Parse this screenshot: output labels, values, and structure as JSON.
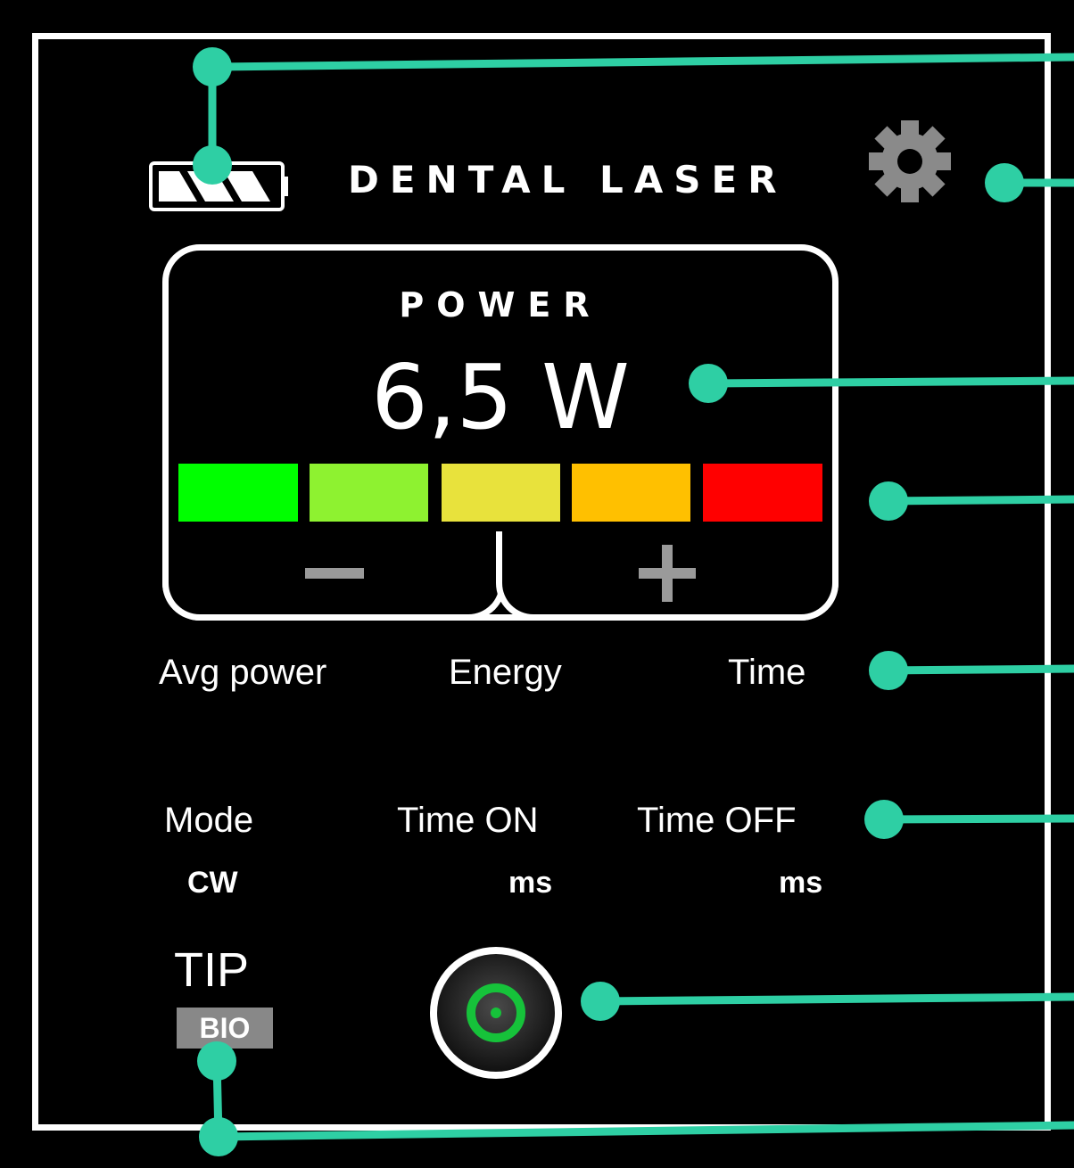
{
  "header": {
    "title": "DENTAL LASER",
    "battery_icon": "battery-icon",
    "settings_icon": "gear-icon"
  },
  "power": {
    "label": "POWER",
    "value": "6,5 W",
    "minus_icon": "minus-icon",
    "plus_icon": "plus-icon"
  },
  "power_scale": {
    "colors": [
      "#00ff00",
      "#8ef230",
      "#e8e23c",
      "#ffc000",
      "#ff0000"
    ]
  },
  "metrics": {
    "avg_power": "Avg power",
    "energy": "Energy",
    "time": "Time"
  },
  "settings": {
    "mode_label": "Mode",
    "mode_value": "CW",
    "time_on_label": "Time ON",
    "time_on_unit": "ms",
    "time_off_label": "Time OFF",
    "time_off_unit": "ms"
  },
  "tip": {
    "label": "TIP",
    "type": "BIO"
  },
  "start_button_icon": "power-start-icon",
  "annotation_color": "#2ecfa4"
}
